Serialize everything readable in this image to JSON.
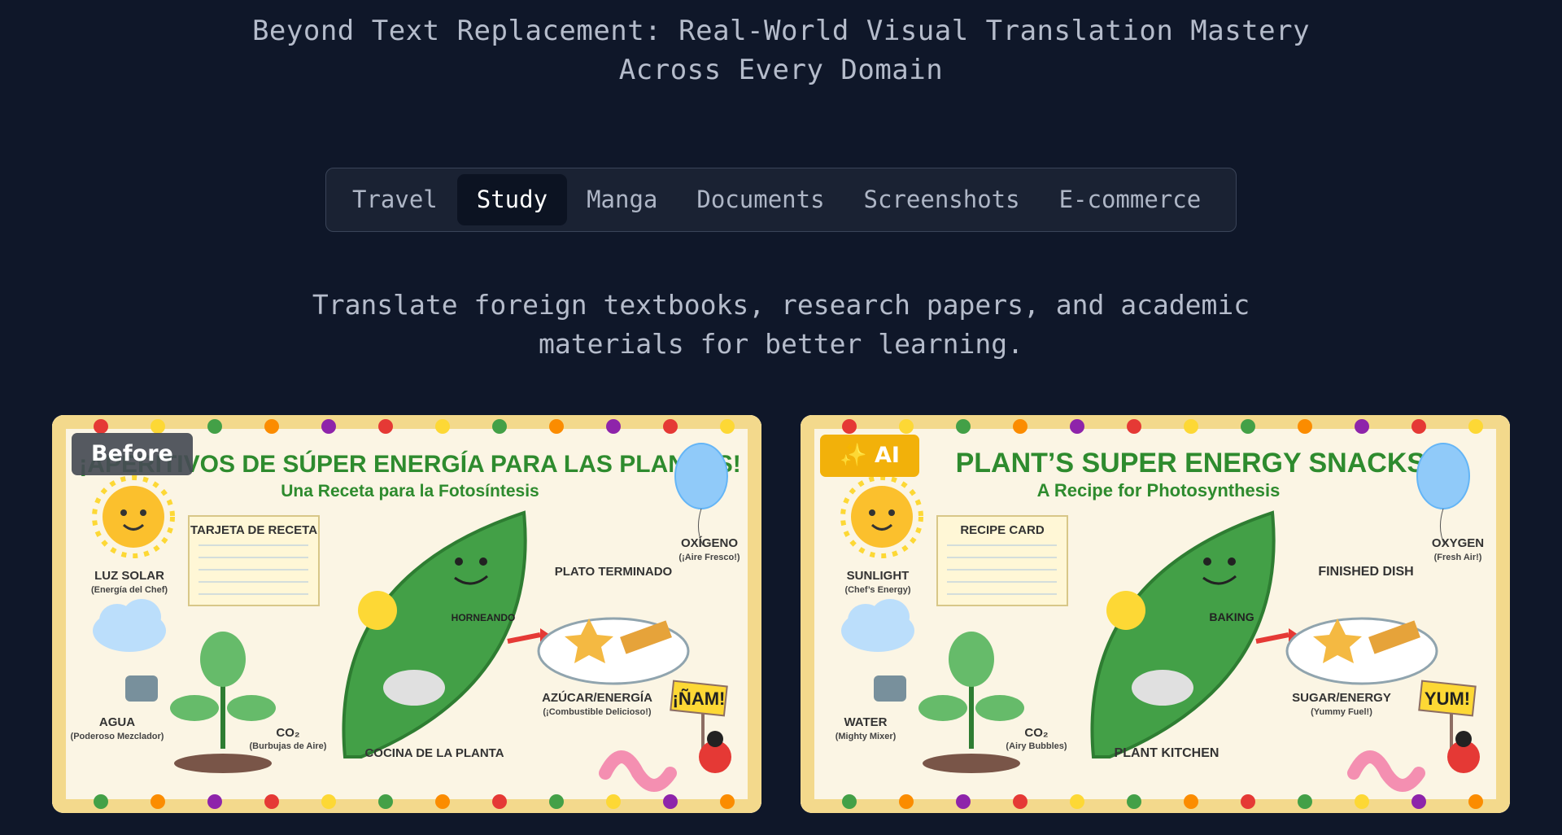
{
  "header": {
    "title": "Beyond Text Replacement: Real-World Visual Translation Mastery Across Every Domain"
  },
  "tabs": [
    {
      "label": "Travel",
      "active": false
    },
    {
      "label": "Study",
      "active": true
    },
    {
      "label": "Manga",
      "active": false
    },
    {
      "label": "Documents",
      "active": false
    },
    {
      "label": "Screenshots",
      "active": false
    },
    {
      "label": "E-commerce",
      "active": false
    }
  ],
  "description": "Translate foreign textbooks, research papers, and academic materials for better learning.",
  "comparison": {
    "before": {
      "badge": "Before",
      "title": "¡APERITIVOS DE SÚPER ENERGÍA PARA LAS PLANTAS!",
      "subtitle": "Una Receta para la Fotosíntesis",
      "labels": {
        "recipe_card": "TARJETA DE RECETA",
        "sun": "LUZ SOLAR",
        "sun_sub": "(Energía del Chef)",
        "water": "AGUA",
        "water_sub": "(Poderoso Mezclador)",
        "co2": "CO₂",
        "co2_sub": "(Burbujas de Aire)",
        "baking": "HORNEANDO",
        "kitchen": "COCINA DE LA PLANTA",
        "dish": "PLATO TERMINADO",
        "oxygen": "OXÍGENO",
        "oxygen_sub": "(¡Aire Fresco!)",
        "sugar": "AZÚCAR/ENERGÍA",
        "sugar_sub": "(¡Combustible Delicioso!)",
        "sign": "¡ÑAM!"
      }
    },
    "after": {
      "badge": "✨ AI",
      "title": "PLANT’S SUPER ENERGY SNACKS!",
      "subtitle": "A Recipe for Photosynthesis",
      "labels": {
        "recipe_card": "RECIPE CARD",
        "sun": "SUNLIGHT",
        "sun_sub": "(Chef’s Energy)",
        "water": "WATER",
        "water_sub": "(Mighty Mixer)",
        "co2": "CO₂",
        "co2_sub": "(Airy Bubbles)",
        "baking": "BAKING",
        "kitchen": "PLANT KITCHEN",
        "dish": "FINISHED DISH",
        "oxygen": "OXYGEN",
        "oxygen_sub": "(Fresh Air!)",
        "sugar": "SUGAR/ENERGY",
        "sugar_sub": "(Yummy Fuel!)",
        "sign": "YUM!"
      }
    }
  },
  "colors": {
    "background": "#0f1729",
    "tab_active_bg": "#0c1322",
    "ai_badge": "#f2b10a",
    "poster_green": "#2e8b2e"
  }
}
